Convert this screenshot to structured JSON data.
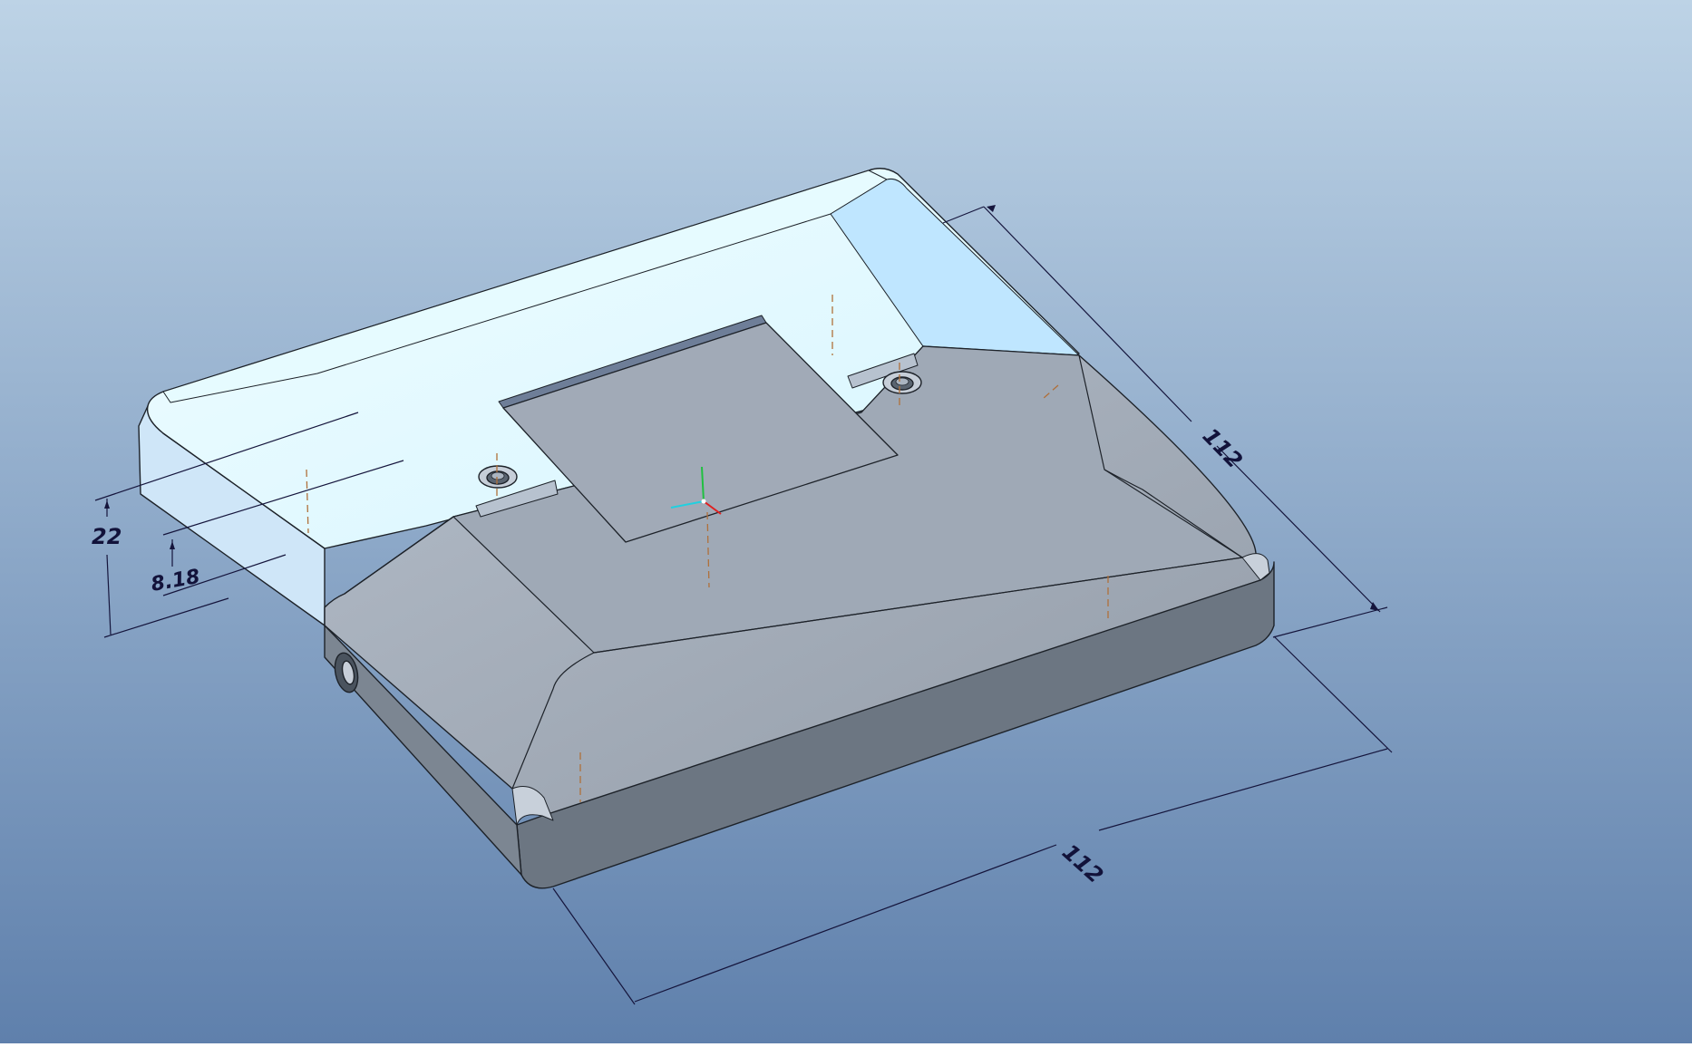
{
  "viewport": {
    "background_top": "#bdd3e6",
    "background_bottom": "#5f80ac"
  },
  "model": {
    "top_face_color": "#dff9ff",
    "left_side_color": "#cde4f7",
    "gray_face_color": "#a3adba",
    "front_side_color": "#6d7782",
    "edge_color": "#1d2229",
    "hidden_axis_color": "#b0703a"
  },
  "dimensions": {
    "depth": "112",
    "width": "112",
    "height": "22",
    "step": "8.18",
    "line_color": "#15153c"
  },
  "csys": {
    "x_color": "#e02020",
    "y_color": "#20c040",
    "z_color": "#20d0e0"
  }
}
